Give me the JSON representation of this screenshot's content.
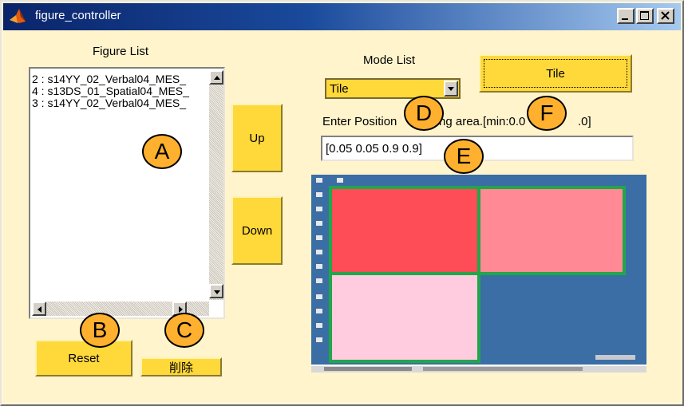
{
  "window": {
    "title": "figure_controller"
  },
  "figure_list": {
    "label": "Figure List",
    "items": [
      "2 : s14YY_02_Verbal04_MES_",
      "4 : s13DS_01_Spatial04_MES_",
      "3 : s14YY_02_Verbal04_MES_"
    ]
  },
  "buttons": {
    "up": "Up",
    "down": "Down",
    "reset": "Reset",
    "delete": "削除",
    "tile": "Tile"
  },
  "mode": {
    "label": "Mode List",
    "selected": "Tile"
  },
  "position": {
    "label": "Enter Position",
    "label_tail": "ng area.[min:0.0",
    "label_end": ".0]",
    "value": "[0.05 0.05 0.9 0.9]"
  },
  "markers": {
    "a": "A",
    "b": "B",
    "c": "C",
    "d": "D",
    "e": "E",
    "f": "F"
  },
  "colors": {
    "tile_red": "#ff4d57",
    "tile_pink": "#ff8a96",
    "tile_light": "#ffccdf",
    "desktop_blue": "#3a6ea5",
    "tile_border": "#22a64a",
    "accent_yellow": "#ffd83a",
    "marker_orange": "#ffb02e"
  }
}
